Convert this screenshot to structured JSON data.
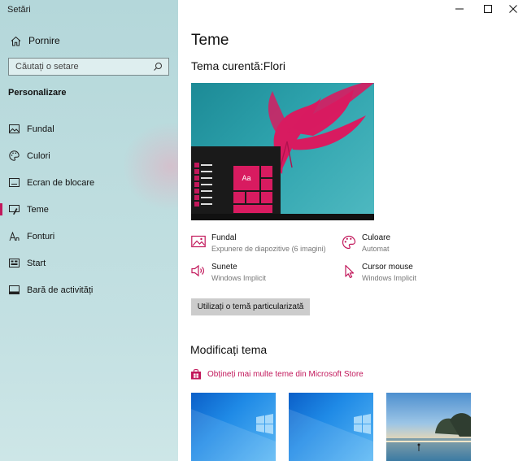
{
  "window": {
    "title": "Setări"
  },
  "sidebar": {
    "home_label": "Pornire",
    "search_placeholder": "Căutați o setare",
    "section_heading": "Personalizare",
    "items": [
      {
        "label": "Fundal",
        "icon": "picture-icon"
      },
      {
        "label": "Culori",
        "icon": "palette-icon"
      },
      {
        "label": "Ecran de blocare",
        "icon": "lock-screen-icon"
      },
      {
        "label": "Teme",
        "icon": "theme-brush-icon",
        "active": true
      },
      {
        "label": "Fonturi",
        "icon": "font-icon"
      },
      {
        "label": "Start",
        "icon": "start-icon"
      },
      {
        "label": "Bară de activități",
        "icon": "taskbar-icon"
      }
    ]
  },
  "main": {
    "page_title": "Teme",
    "current_theme": "Tema curentă:Flori",
    "preview_tile_text": "Aa",
    "attributes": {
      "background": {
        "name": "Fundal",
        "value": "Expunere de diapozitive (6 imagini)",
        "icon": "picture-icon"
      },
      "color": {
        "name": "Culoare",
        "value": "Automat",
        "icon": "palette-icon"
      },
      "sounds": {
        "name": "Sunete",
        "value": "Windows Implicit",
        "icon": "speaker-icon"
      },
      "cursor": {
        "name": "Cursor mouse",
        "value": "Windows Implicit",
        "icon": "cursor-icon"
      }
    },
    "custom_theme_button": "Utilizați o temă particularizată",
    "change_theme_heading": "Modificați tema",
    "store_link": "Obțineți mai multe teme din Microsoft Store",
    "thumbnails": [
      "windows-theme",
      "windows-theme",
      "beach-theme"
    ]
  },
  "colors": {
    "accent": "#c2185b",
    "sidebar_bg": "#bcdcde"
  }
}
